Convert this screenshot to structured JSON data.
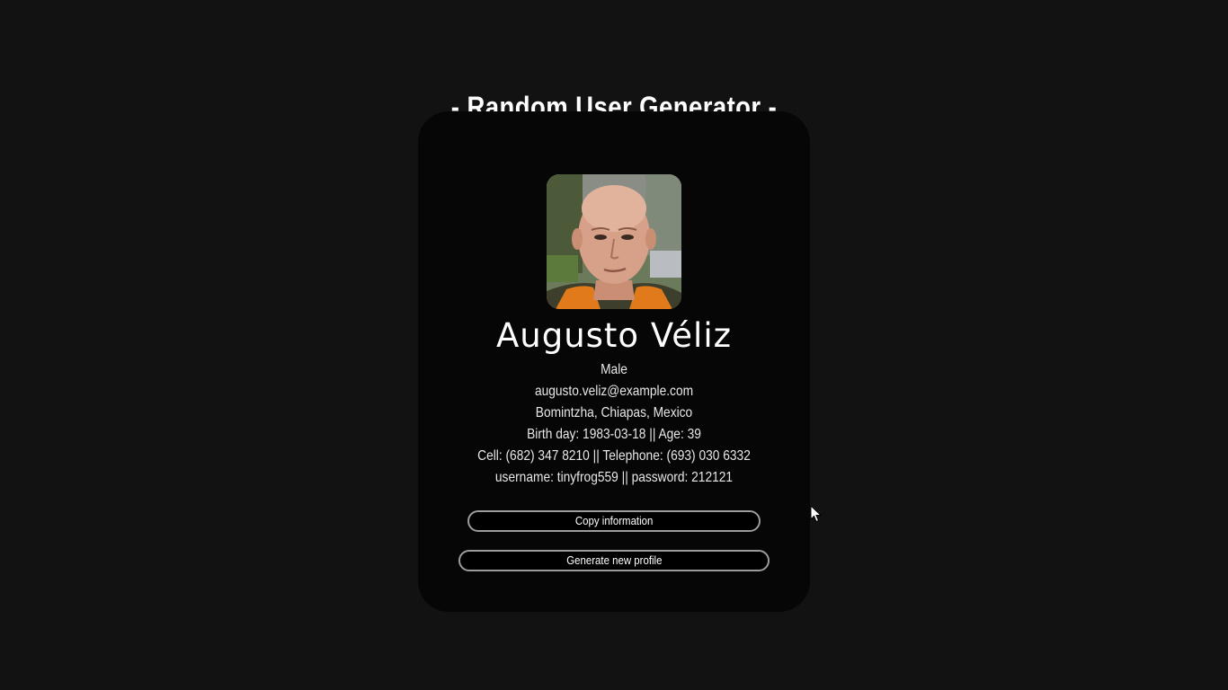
{
  "page": {
    "title": "- Random User Generator -"
  },
  "profile": {
    "avatar_alt": "profile-photo",
    "name": "Augusto Véliz",
    "gender": "Male",
    "email": "augusto.veliz@example.com",
    "location": "Bomintzha, Chiapas, Mexico",
    "birth_line": "Birth day: 1983-03-18 || Age: 39",
    "phone_line": "Cell: (682) 347 8210 || Telephone: (693) 030 6332",
    "credentials_line": "username: tinyfrog559 || password: 212121"
  },
  "actions": {
    "copy_label": "Copy information",
    "generate_label": "Generate new profile"
  },
  "colors": {
    "page_background": "#121212",
    "card_background": "#060606",
    "button_border": "#9c9c9c",
    "text": "#ffffff"
  }
}
